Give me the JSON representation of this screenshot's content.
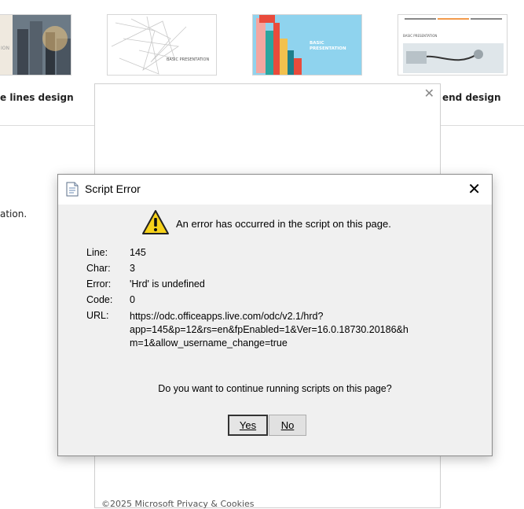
{
  "templates": [
    {
      "caption": "e lines design",
      "thumb_text": "ION"
    },
    {
      "caption": "",
      "thumb_text": "BASIC PRESENTATION"
    },
    {
      "caption": "",
      "thumb_text": "BASIC\nPRESENTATION"
    },
    {
      "caption": "end design",
      "thumb_text": "BASIC PRESENTATION"
    }
  ],
  "side_text": "ation.",
  "background_dialog": {
    "footer": "©2025 Microsoft    Privacy & Cookies"
  },
  "error_dialog": {
    "title": "Script Error",
    "message": "An error has occurred in the script on this page.",
    "rows": [
      {
        "label": "Line:",
        "value": "145"
      },
      {
        "label": "Char:",
        "value": "3"
      },
      {
        "label": "Error:",
        "value": "'Hrd' is undefined"
      },
      {
        "label": "Code:",
        "value": "0"
      }
    ],
    "url_label": "URL:",
    "url_lines": [
      "https://odc.officeapps.live.com/odc/v2.1/hrd?",
      "app=145&p=12&rs=en&fpEnabled=1&Ver=16.0.18730.20186&h",
      "m=1&allow_username_change=true"
    ],
    "question": "Do you want to continue running scripts on this page?",
    "yes_label": "Yes",
    "no_label": "No"
  },
  "colors": {
    "dialog_bg": "#f0f0f0",
    "title_bg": "#ffffff",
    "warning_yellow": "#f7d21a",
    "thumb3_bg": "#8fd3ee"
  }
}
